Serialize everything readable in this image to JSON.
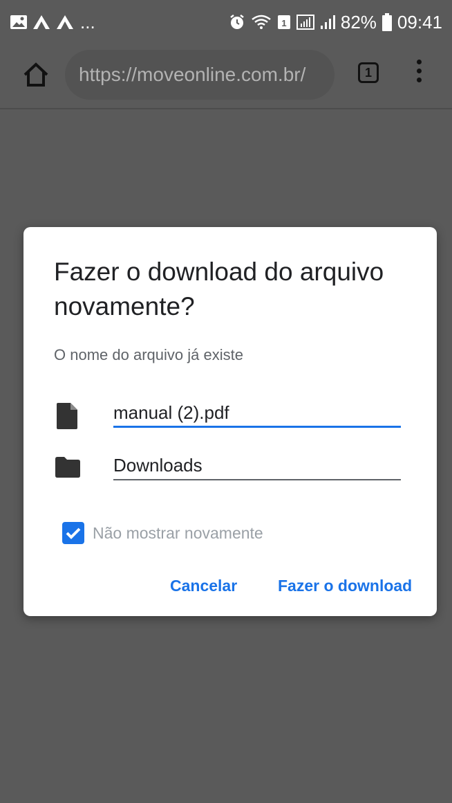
{
  "status_bar": {
    "dots": "...",
    "battery_percent": "82%",
    "time": "09:41"
  },
  "browser": {
    "url": "https://moveonline.com.br/",
    "tab_count": "1"
  },
  "dialog": {
    "title": "Fazer o download do arquivo novamente?",
    "subtitle": "O nome do arquivo já existe",
    "filename": "manual (2).pdf",
    "location": "Downloads",
    "checkbox_label": "Não mostrar novamente",
    "checkbox_checked": true,
    "cancel_label": "Cancelar",
    "download_label": "Fazer o download"
  },
  "colors": {
    "accent": "#1a73e8",
    "scrim": "#5a5a5a"
  }
}
